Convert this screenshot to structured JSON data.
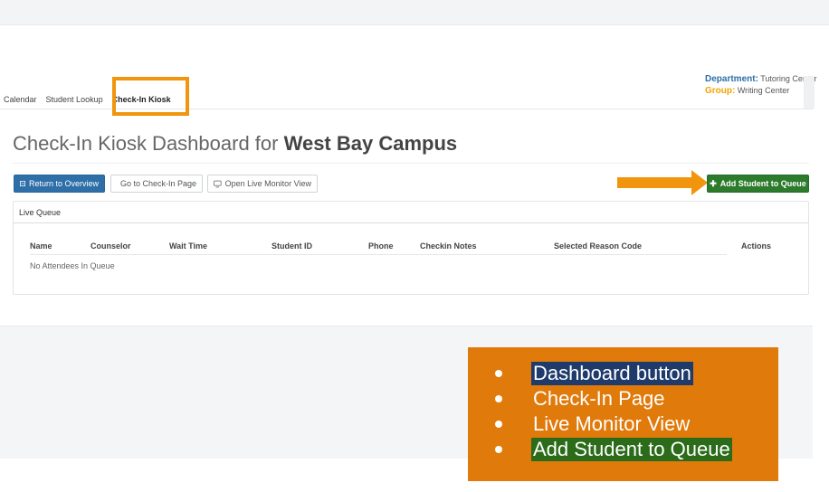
{
  "header": {
    "department_label": "Department:",
    "department_value": "Tutoring Center",
    "group_label": "Group:",
    "group_value": "Writing Center"
  },
  "tabs": [
    {
      "label": "Calendar"
    },
    {
      "label": "Student Lookup"
    },
    {
      "label": "Check-In Kiosk",
      "active": true
    }
  ],
  "page": {
    "title_prefix": "Check-In Kiosk Dashboard for",
    "title_campus": "West Bay Campus"
  },
  "toolbar": {
    "return_label": "Return to Overview",
    "checkin_label": "Go to Check-In Page",
    "monitor_label": "Open Live Monitor View",
    "add_label": "Add Student to Queue"
  },
  "queue": {
    "panel_title": "Live Queue",
    "columns": [
      "Name",
      "Counselor",
      "Wait Time",
      "Student ID",
      "Phone",
      "Checkin Notes",
      "Selected Reason Code",
      "Actions"
    ],
    "empty_message": "No Attendees In Queue"
  },
  "legend": {
    "items": [
      "Dashboard button",
      "Check-In Page",
      "Live Monitor View",
      "Add Student to Queue"
    ]
  },
  "colors": {
    "primary": "#2e6fa8",
    "success": "#2c7a2c",
    "accent_orange": "#f0950d",
    "legend_bg": "#e07a0b"
  }
}
